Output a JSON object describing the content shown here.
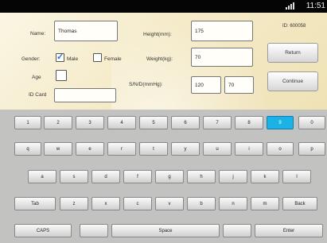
{
  "status_bar": {
    "time": "11:51"
  },
  "form": {
    "name_label": "Name:",
    "name_value": "Thomas",
    "height_label": "Height(mm):",
    "height_value": "175",
    "id_label": "ID: 600058",
    "gender_label": "Gender:",
    "male_label": "Male",
    "male_checked": true,
    "female_label": "Female",
    "female_checked": false,
    "weight_label": "Weight(kg):",
    "weight_value": "70",
    "age_label": "Age",
    "sbp_dbp_label": "S/N/D(mmHg):",
    "sbp_value": "120",
    "dbp_value": "70",
    "idcard_label": "ID Card",
    "idcard_value": "",
    "return_label": "Return",
    "continue_label": "Continue"
  },
  "keyboard": {
    "highlight_color": "#1bb3e6",
    "rows": [
      [
        "1",
        "2",
        "3",
        "4",
        "5",
        "6",
        "7",
        "8",
        "9",
        "0"
      ],
      [
        "q",
        "w",
        "e",
        "r",
        "t",
        "y",
        "u",
        "i",
        "o",
        "p"
      ],
      [
        "a",
        "s",
        "d",
        "f",
        "g",
        "h",
        "j",
        "k",
        "l"
      ],
      [
        "Tab",
        "z",
        "x",
        "c",
        "v",
        "b",
        "n",
        "m",
        "Back"
      ],
      [
        "CAPS",
        "",
        "Space",
        "",
        "Enter"
      ]
    ],
    "highlighted": "9"
  }
}
